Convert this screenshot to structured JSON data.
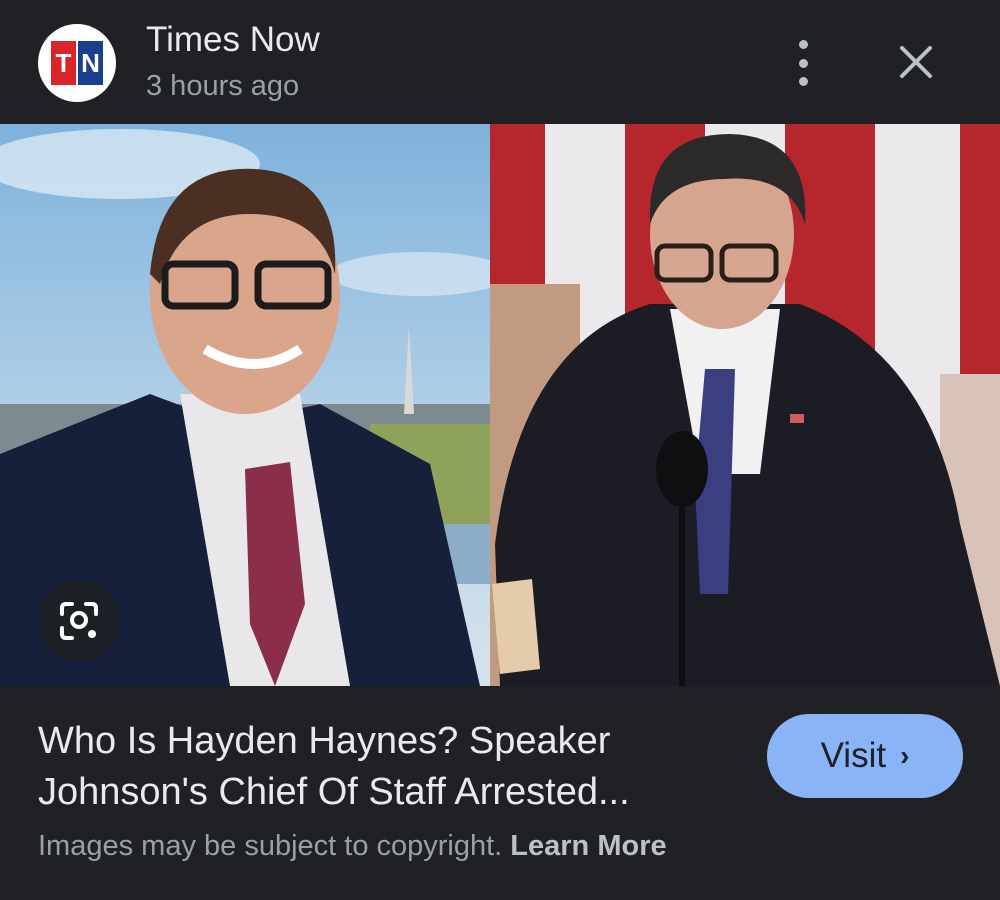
{
  "header": {
    "logo_text": "TN",
    "logo_left": "T",
    "logo_right": "N",
    "source": "Times Now",
    "time": "3 hours ago"
  },
  "icons": {
    "more": "more-vert-icon",
    "close": "close-icon",
    "lens": "google-lens-icon",
    "visit": "chevron-right-icon"
  },
  "article": {
    "title_line1": "Who Is Hayden Haynes? Speaker",
    "title_line2": "Johnson's Chief Of Staff Arrested..."
  },
  "visit_label": "Visit",
  "footer": {
    "copyright": "Images may be subject to copyright.",
    "learn_more": "Learn More"
  },
  "colors": {
    "background": "#202124",
    "visit_button": "#8ab4f8",
    "logo_red": "#d9252a",
    "logo_blue": "#1b3f8f"
  }
}
